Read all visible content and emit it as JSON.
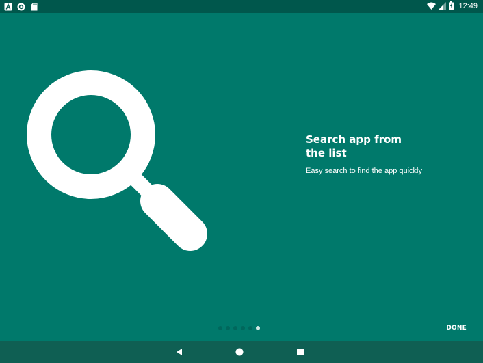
{
  "status_bar": {
    "time": "12:49",
    "left_icons": [
      "a-box-icon",
      "circle-dot-icon",
      "sd-card-icon"
    ],
    "right_icons": [
      "wifi-icon",
      "cell-signal-icon",
      "battery-icon"
    ]
  },
  "onboarding": {
    "hero_icon": "search-icon",
    "title": "Search app from the list",
    "description": "Easy search to find the app quickly",
    "pager": {
      "total": 6,
      "current": 6
    },
    "done_label": "DONE"
  },
  "nav_bar": {
    "buttons": [
      "back-icon",
      "home-icon",
      "recents-icon"
    ]
  },
  "colors": {
    "background": "#00796b",
    "status_bar": "#00574c",
    "nav_bar": "#0f5f53",
    "foreground": "#ffffff",
    "dot_inactive": "#00675c",
    "dot_active": "#cfe7e3"
  }
}
